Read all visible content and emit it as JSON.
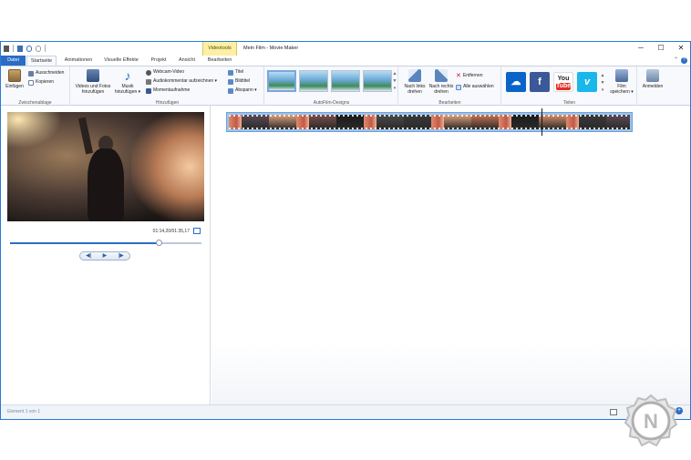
{
  "window": {
    "title": "Mein Film - Movie Maker",
    "context_tab": "Videotools",
    "controls": {
      "minimize": "─",
      "maximize": "☐",
      "close": "✕"
    }
  },
  "tabs": {
    "file": "Datei",
    "items": [
      "Startseite",
      "Animationen",
      "Visuelle Effekte",
      "Projekt",
      "Ansicht",
      "Bearbeiten"
    ]
  },
  "ribbon": {
    "clipboard": {
      "label": "Zwischenablage",
      "paste": "Einfügen",
      "cut": "Ausschneiden",
      "copy": "Kopieren"
    },
    "add": {
      "label": "Hinzufügen",
      "add_videos_line1": "Videos und Fotos",
      "add_videos_line2": "hinzufügen",
      "music_line1": "Musik",
      "music_line2": "hinzufügen ▾",
      "webcam": "Webcam-Video",
      "narration": "Audiokommentar aufzeichnen ▾",
      "snapshot": "Momentaufnahme",
      "title": "Titel",
      "caption": "Bildtitel",
      "credits": "Abspann ▾"
    },
    "themes": {
      "label": "AutoFilm-Designs"
    },
    "edit": {
      "label": "Bearbeiten",
      "rotate_left_line1": "Nach links",
      "rotate_left_line2": "drehen",
      "rotate_right_line1": "Nach rechts",
      "rotate_right_line2": "drehen",
      "remove": "Entfernen",
      "select_all": "Alle auswählen"
    },
    "share": {
      "label": "Teilen",
      "onedrive": "☁",
      "facebook": "f",
      "youtube_line1": "You",
      "youtube_line2": "Tube",
      "vimeo": "v",
      "save_movie_line1": "Film",
      "save_movie_line2": "speichern ▾"
    },
    "sign_in": "Anmelden"
  },
  "preview": {
    "timecode": "01:14,20/01:35,17",
    "progress": 0.775,
    "prev_frame": "◀|",
    "play": "▶",
    "next_frame": "|▶"
  },
  "statusbar": {
    "text": "Element 1 von 1",
    "zoom_minus": "−",
    "zoom_plus": "+"
  },
  "colors": {
    "accent": "#2b6cc4",
    "context_tab_bg": "#fbf0a6",
    "facebook": "#3b5998",
    "youtube": "#e52d27",
    "vimeo": "#1ab7ea",
    "onedrive": "#0a64c8"
  },
  "watermark": {
    "letter": "N"
  }
}
